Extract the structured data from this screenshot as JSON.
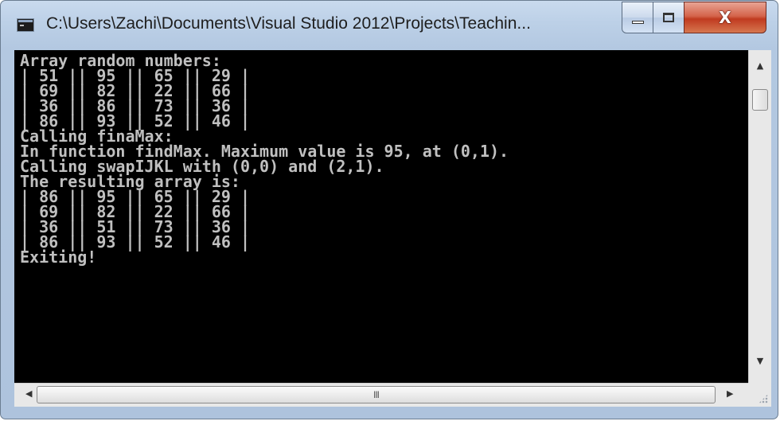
{
  "window": {
    "title": "C:\\Users\\Zachi\\Documents\\Visual Studio 2012\\Projects\\Teachin...",
    "minimize_icon": "minimize-icon",
    "maximize_icon": "maximize-icon",
    "close_glyph": "X"
  },
  "console": {
    "lines": [
      "Array random numbers:",
      "| 51 || 95 || 65 || 29 |",
      "| 69 || 82 || 22 || 66 |",
      "| 36 || 86 || 73 || 36 |",
      "| 86 || 93 || 52 || 46 |",
      "Calling finaMax:",
      "In function findMax. Maximum value is 95, at (0,1).",
      "Calling swapIJKL with (0,0) and (2,1).",
      "The resulting array is:",
      "| 86 || 95 || 65 || 29 |",
      "| 69 || 82 || 22 || 66 |",
      "| 36 || 51 || 73 || 36 |",
      "| 86 || 93 || 52 || 46 |",
      "Exiting!"
    ],
    "colors": {
      "background": "#000000",
      "text": "#c0c0c0"
    }
  },
  "scrollbars": {
    "up_arrow": "▲",
    "down_arrow": "▼",
    "left_arrow": "◀",
    "right_arrow": "▶",
    "hthumb_grip": "III"
  }
}
